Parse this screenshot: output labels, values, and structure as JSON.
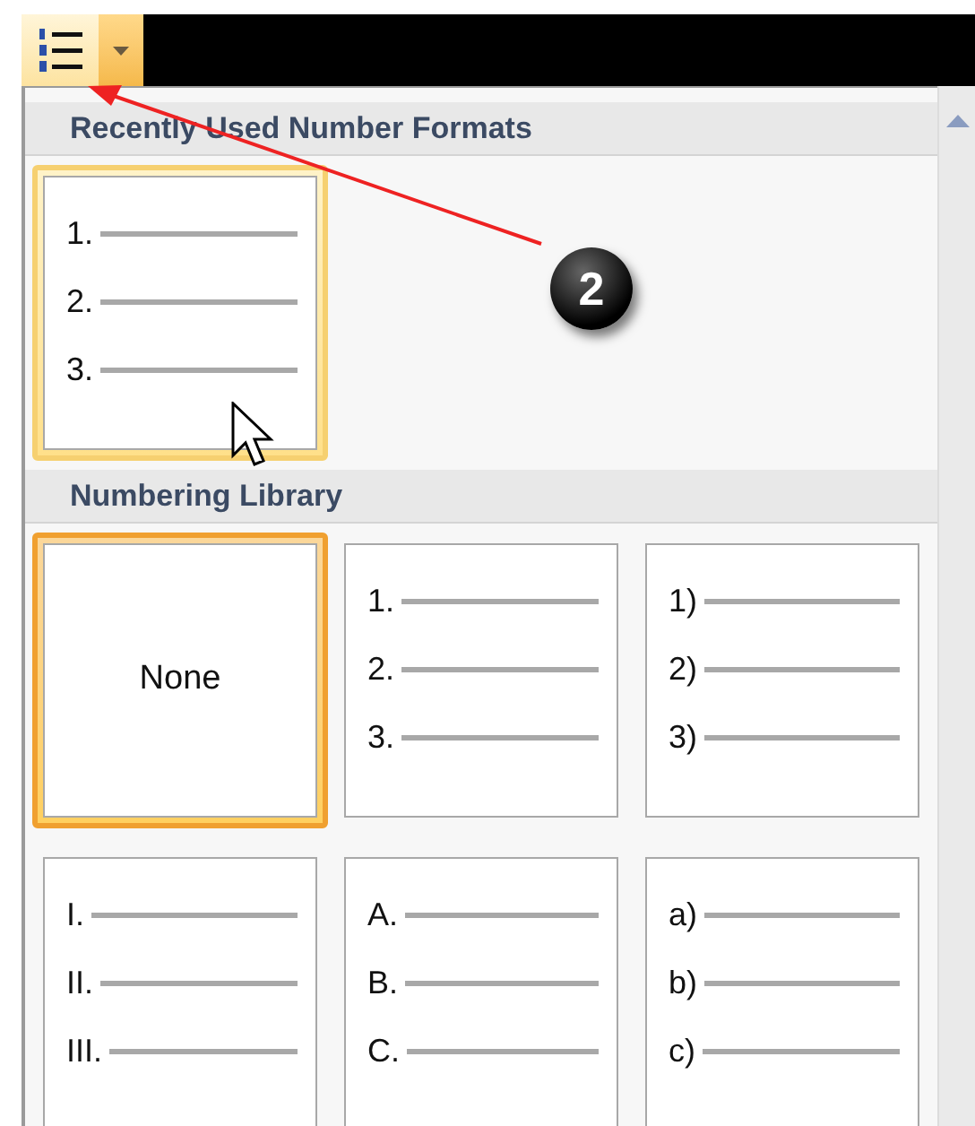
{
  "toolbar": {
    "numbering_button": {
      "selected": true
    }
  },
  "sections": [
    {
      "title": "Recently Used Number Formats",
      "items": [
        {
          "kind": "list",
          "markers": [
            "1.",
            "2.",
            "3."
          ],
          "hovered": true,
          "selected": false
        }
      ]
    },
    {
      "title": "Numbering Library",
      "items": [
        {
          "kind": "none",
          "label": "None",
          "hovered": false,
          "selected": true
        },
        {
          "kind": "list",
          "markers": [
            "1.",
            "2.",
            "3."
          ],
          "hovered": false,
          "selected": false
        },
        {
          "kind": "list",
          "markers": [
            "1)",
            "2)",
            "3)"
          ],
          "hovered": false,
          "selected": false
        },
        {
          "kind": "list",
          "markers": [
            "I.",
            "II.",
            "III."
          ],
          "hovered": false,
          "selected": false
        },
        {
          "kind": "list",
          "markers": [
            "A.",
            "B.",
            "C."
          ],
          "hovered": false,
          "selected": false
        },
        {
          "kind": "list",
          "markers": [
            "a)",
            "b)",
            "c)"
          ],
          "hovered": false,
          "selected": false
        }
      ]
    }
  ],
  "callout": {
    "number": "2"
  }
}
